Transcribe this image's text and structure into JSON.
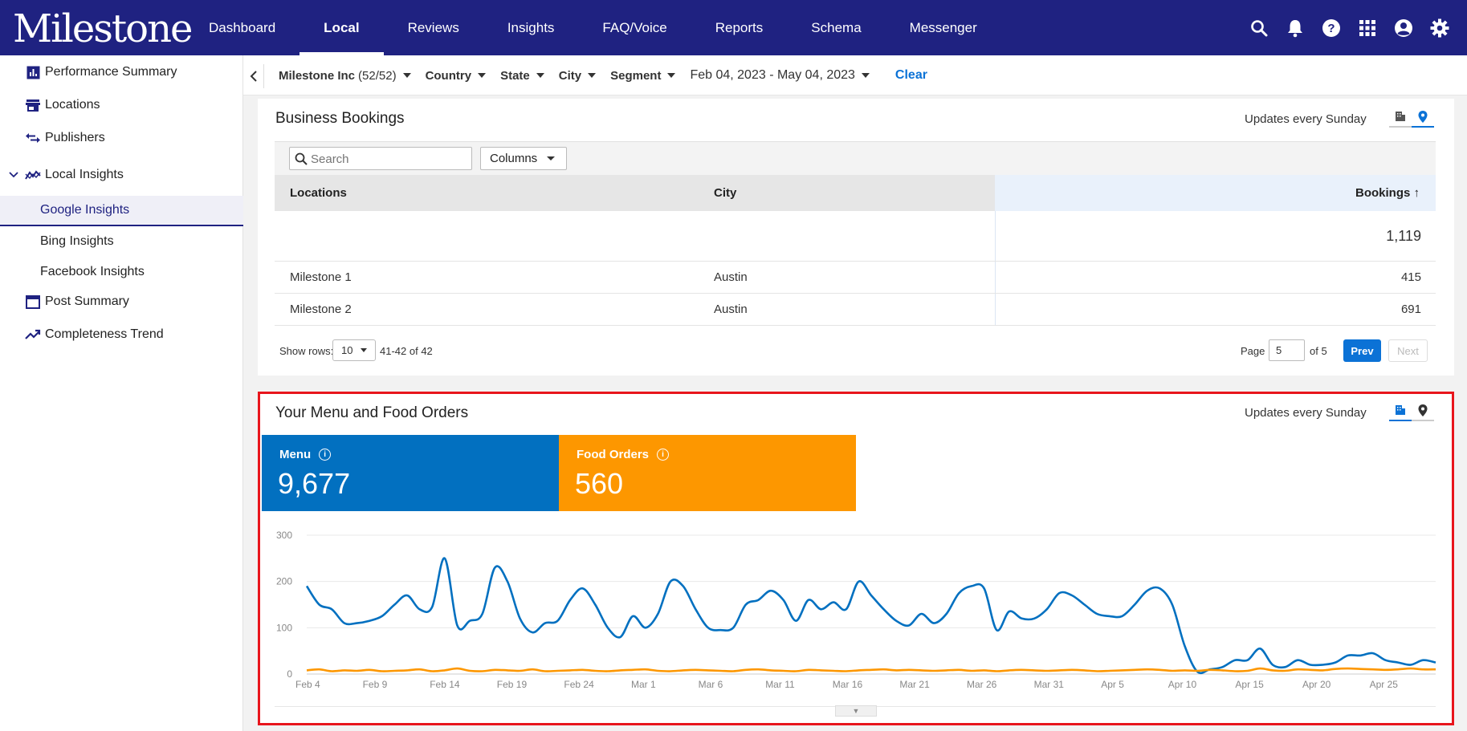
{
  "brand": {
    "logo_text": "Milestone",
    "nav_bg": "#1f2281",
    "accent": "#0b72d6"
  },
  "nav": {
    "items": [
      {
        "label": "Dashboard"
      },
      {
        "label": "Local",
        "active": true
      },
      {
        "label": "Reviews"
      },
      {
        "label": "Insights"
      },
      {
        "label": "FAQ/Voice"
      },
      {
        "label": "Reports"
      },
      {
        "label": "Schema"
      },
      {
        "label": "Messenger"
      }
    ],
    "icons": [
      "search-icon",
      "bell-icon",
      "help-icon",
      "apps-grid-icon",
      "account-icon",
      "gear-icon"
    ]
  },
  "sidebar": {
    "items": [
      {
        "label": "Performance Summary",
        "icon": "bar-chart-icon"
      },
      {
        "label": "Locations",
        "icon": "store-icon"
      },
      {
        "label": "Publishers",
        "icon": "swap-icon"
      },
      {
        "label": "Local Insights",
        "icon": "trend-icon",
        "expanded": true
      },
      {
        "label": "Google Insights",
        "active": true
      },
      {
        "label": "Bing Insights"
      },
      {
        "label": "Facebook Insights"
      },
      {
        "label": "Post Summary",
        "icon": "calendar-icon"
      },
      {
        "label": "Completeness Trend",
        "icon": "trending-up-icon"
      }
    ]
  },
  "filters": {
    "account": "Milestone Inc",
    "account_count": "(52/52)",
    "country": "Country",
    "state": "State",
    "city": "City",
    "segment": "Segment",
    "date_range": "Feb 04, 2023 - May 04, 2023",
    "clear": "Clear"
  },
  "bookings": {
    "title": "Business Bookings",
    "updates": "Updates every Sunday",
    "search_placeholder": "Search",
    "columns_label": "Columns",
    "headers": {
      "locations": "Locations",
      "city": "City",
      "bookings": "Bookings ↑"
    },
    "total": "1,119",
    "rows": [
      {
        "location": "Milestone 1",
        "city": "Austin",
        "bookings": "415"
      },
      {
        "location": "Milestone 2",
        "city": "Austin",
        "bookings": "691"
      }
    ],
    "pager": {
      "show_rows_label": "Show rows:",
      "rows_value": "10",
      "range_text": "41-42 of 42",
      "page_label": "Page",
      "page_value": "5",
      "of_text": "of 5",
      "prev": "Prev",
      "next": "Next"
    }
  },
  "menu_orders": {
    "title": "Your Menu and Food Orders",
    "updates": "Updates every Sunday",
    "kpis": [
      {
        "label": "Menu",
        "value": "9,677",
        "color": "#0270c0"
      },
      {
        "label": "Food Orders",
        "value": "560",
        "color": "#fd9700"
      }
    ]
  },
  "chart_data": {
    "type": "line",
    "ylim": [
      0,
      300
    ],
    "yticks": [
      "0",
      "100",
      "200",
      "300"
    ],
    "x_tick_labels": [
      "Feb 4",
      "Feb 9",
      "Feb 14",
      "Feb 19",
      "Feb 24",
      "Mar 1",
      "Mar 6",
      "Mar 11",
      "Mar 16",
      "Mar 21",
      "Mar 26",
      "Mar 31",
      "Apr 5",
      "Apr 10",
      "Apr 15",
      "Apr 20",
      "Apr 25"
    ],
    "series": [
      {
        "color": "#0270c0",
        "values": [
          190,
          150,
          140,
          110,
          110,
          115,
          125,
          150,
          170,
          140,
          145,
          250,
          105,
          115,
          130,
          230,
          200,
          120,
          90,
          110,
          115,
          160,
          185,
          150,
          100,
          80,
          125,
          100,
          130,
          200,
          190,
          140,
          100,
          95,
          100,
          150,
          160,
          180,
          160,
          115,
          160,
          140,
          155,
          140,
          200,
          170,
          140,
          115,
          105,
          130,
          110,
          130,
          175,
          190,
          185,
          95,
          135,
          120,
          120,
          140,
          175,
          170,
          150,
          130,
          125,
          125,
          150,
          180,
          185,
          150,
          60,
          5,
          10,
          15,
          30,
          30,
          55,
          20,
          15,
          30,
          20,
          20,
          25,
          40,
          40,
          45,
          30,
          25,
          20,
          30,
          25
        ]
      },
      {
        "color": "#fd9700",
        "values": [
          8,
          10,
          6,
          8,
          7,
          9,
          6,
          7,
          8,
          10,
          6,
          8,
          12,
          7,
          6,
          9,
          8,
          7,
          10,
          6,
          7,
          8,
          9,
          7,
          6,
          8,
          9,
          10,
          7,
          6,
          8,
          9,
          8,
          7,
          6,
          9,
          10,
          8,
          7,
          6,
          9,
          8,
          7,
          6,
          8,
          9,
          10,
          8,
          9,
          8,
          7,
          8,
          9,
          7,
          8,
          6,
          8,
          9,
          8,
          7,
          8,
          9,
          8,
          6,
          7,
          8,
          9,
          10,
          9,
          7,
          8,
          7,
          9,
          8,
          6,
          7,
          12,
          8,
          7,
          10,
          9,
          8,
          11,
          12,
          11,
          10,
          9,
          10,
          12,
          10,
          10
        ]
      }
    ]
  }
}
